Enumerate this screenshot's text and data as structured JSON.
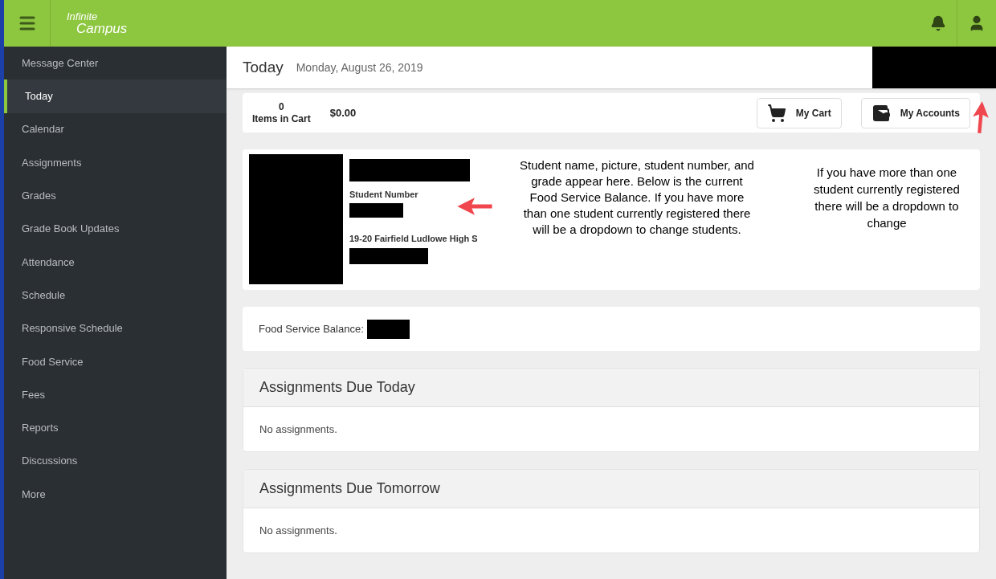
{
  "header": {
    "logo_top": "Infinite",
    "logo_bottom": "Campus"
  },
  "sidebar": {
    "items": [
      {
        "label": "Message Center",
        "selected": false
      },
      {
        "label": "Today",
        "selected": true
      },
      {
        "label": "Calendar",
        "selected": false
      },
      {
        "label": "Assignments",
        "selected": false
      },
      {
        "label": "Grades",
        "selected": false
      },
      {
        "label": "Grade Book Updates",
        "selected": false
      },
      {
        "label": "Attendance",
        "selected": false
      },
      {
        "label": "Schedule",
        "selected": false
      },
      {
        "label": "Responsive Schedule",
        "selected": false
      },
      {
        "label": "Food Service",
        "selected": false
      },
      {
        "label": "Fees",
        "selected": false
      },
      {
        "label": "Reports",
        "selected": false
      },
      {
        "label": "Discussions",
        "selected": false
      },
      {
        "label": "More",
        "selected": false
      }
    ]
  },
  "page": {
    "title": "Today",
    "date": "Monday, August 26, 2019"
  },
  "cart": {
    "count": "0",
    "count_label": "Items in Cart",
    "total": "$0.00",
    "buttons": [
      {
        "kind": "cart",
        "label": "My Cart"
      },
      {
        "kind": "wallet",
        "label": "My Accounts"
      }
    ]
  },
  "student": {
    "number_label": "Student Number",
    "school": "19-20 Fairfield Ludlowe High S"
  },
  "annotations": [
    "Student name, picture, student number, and grade appear here. Below is the current Food Service Balance. If you have more than one student currently registered there will be a dropdown to change students.",
    "If you have more than one student currently registered there will be a dropdown to change"
  ],
  "food": {
    "label": "Food Service Balance:"
  },
  "sections": [
    {
      "title": "Assignments Due Today",
      "empty": "No assignments."
    },
    {
      "title": "Assignments Due Tomorrow",
      "empty": "No assignments."
    }
  ]
}
